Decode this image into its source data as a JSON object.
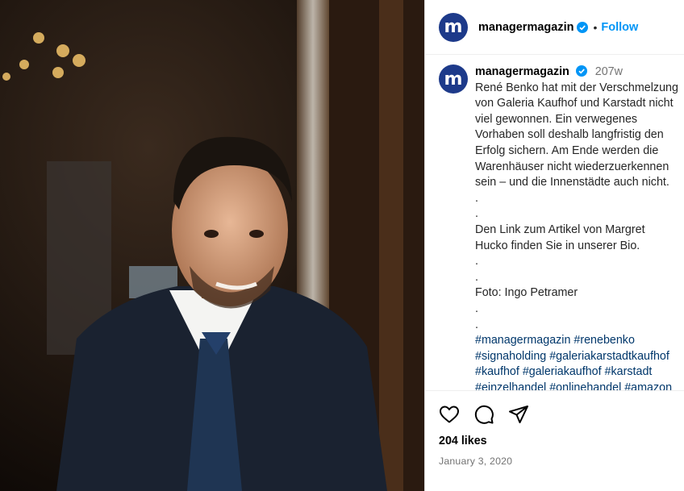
{
  "post": {
    "username": "managermagazin",
    "avatar_letter": "m",
    "follow_label": "Follow",
    "separator": "•",
    "age": "207w",
    "caption_lines": [
      "René Benko hat mit der Verschmelzung",
      "von Galeria Kaufhof und Karstadt nicht",
      "viel gewonnen. Ein verwegenes",
      "Vorhaben soll deshalb langfristig den",
      "Erfolg sichern. Am Ende werden die",
      "Warenhäuser nicht wiederzuerkennen",
      "sein – und die Innenstädte auch nicht.",
      ".",
      ".",
      "Den Link zum Artikel von Margret",
      "Hucko finden Sie in unserer Bio.",
      ".",
      ".",
      "Foto: Ingo Petramer",
      ".",
      "."
    ],
    "hashtag_lines": [
      "#managermagazin #renebenko",
      "#signaholding #galeriakarstadtkaufhof",
      "#kaufhof #galeriakaufhof #karstadt",
      "#einzelhandel #onlinehandel #amazon"
    ],
    "likes": "204 likes",
    "date": "January 3, 2020"
  },
  "colors": {
    "brand_avatar": "#1d3a8a",
    "follow": "#0095f6",
    "hashtag": "#00376b",
    "verified": "#0095f6"
  },
  "icons": [
    "heart-icon",
    "comment-icon",
    "share-icon",
    "verified-badge-icon"
  ]
}
